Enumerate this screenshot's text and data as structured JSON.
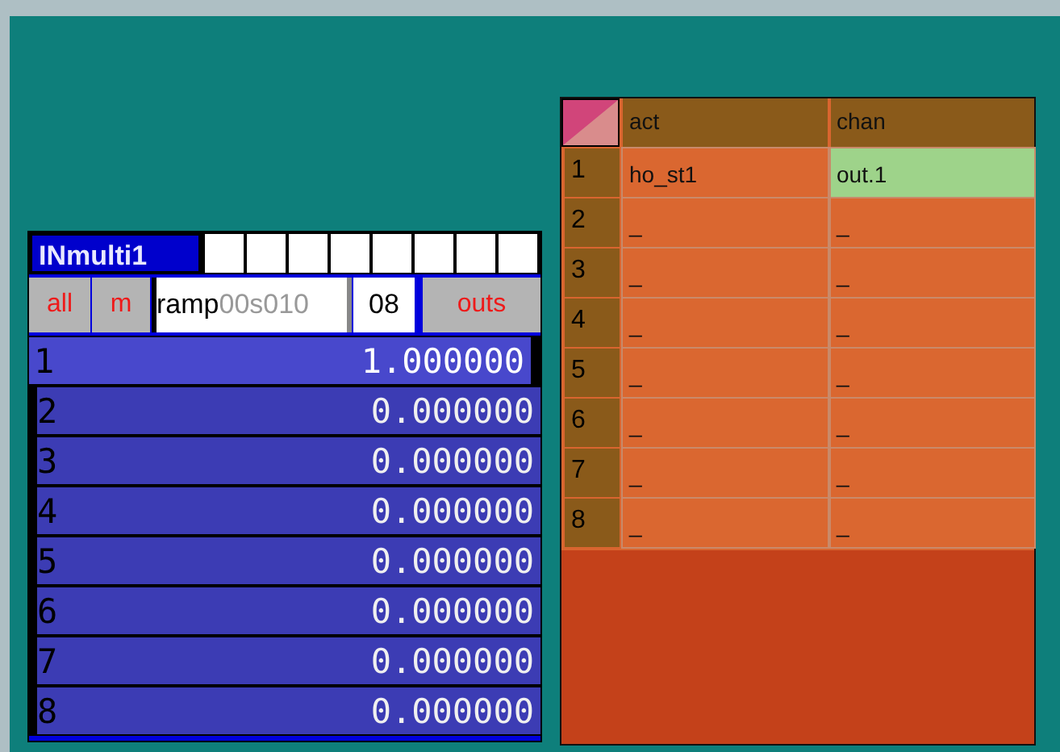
{
  "multi_panel": {
    "title": "INmulti1",
    "slots": [
      {
        "filled": false
      },
      {
        "filled": false
      },
      {
        "filled": false
      },
      {
        "filled": false
      },
      {
        "filled": false
      },
      {
        "filled": false
      },
      {
        "filled": false
      },
      {
        "filled": false
      }
    ],
    "controls": {
      "all": "all",
      "m": "m",
      "name_value": "ramp",
      "name_suffix": "00s010",
      "count": "08",
      "outs": "outs"
    },
    "rows": [
      {
        "index": "1",
        "value": "1.000000",
        "selected": true
      },
      {
        "index": "2",
        "value": "0.000000",
        "selected": false
      },
      {
        "index": "3",
        "value": "0.000000",
        "selected": false
      },
      {
        "index": "4",
        "value": "0.000000",
        "selected": false
      },
      {
        "index": "5",
        "value": "0.000000",
        "selected": false
      },
      {
        "index": "6",
        "value": "0.000000",
        "selected": false
      },
      {
        "index": "7",
        "value": "0.000000",
        "selected": false
      },
      {
        "index": "8",
        "value": "0.000000",
        "selected": false
      }
    ]
  },
  "table": {
    "columns": [
      "act",
      "chan"
    ],
    "rows": [
      {
        "index": "1",
        "cells": [
          {
            "text": "ho_st1",
            "highlighted": false
          },
          {
            "text": "out.1",
            "highlighted": true
          }
        ]
      },
      {
        "index": "2",
        "cells": [
          {
            "text": "_",
            "highlighted": false
          },
          {
            "text": "_",
            "highlighted": false
          }
        ]
      },
      {
        "index": "3",
        "cells": [
          {
            "text": "_",
            "highlighted": false
          },
          {
            "text": "_",
            "highlighted": false
          }
        ]
      },
      {
        "index": "4",
        "cells": [
          {
            "text": "_",
            "highlighted": false
          },
          {
            "text": "_",
            "highlighted": false
          }
        ]
      },
      {
        "index": "5",
        "cells": [
          {
            "text": "_",
            "highlighted": false
          },
          {
            "text": "_",
            "highlighted": false
          }
        ]
      },
      {
        "index": "6",
        "cells": [
          {
            "text": "_",
            "highlighted": false
          },
          {
            "text": "_",
            "highlighted": false
          }
        ]
      },
      {
        "index": "7",
        "cells": [
          {
            "text": "_",
            "highlighted": false
          },
          {
            "text": "_",
            "highlighted": false
          }
        ]
      },
      {
        "index": "8",
        "cells": [
          {
            "text": "_",
            "highlighted": false
          },
          {
            "text": "_",
            "highlighted": false
          }
        ]
      }
    ]
  }
}
